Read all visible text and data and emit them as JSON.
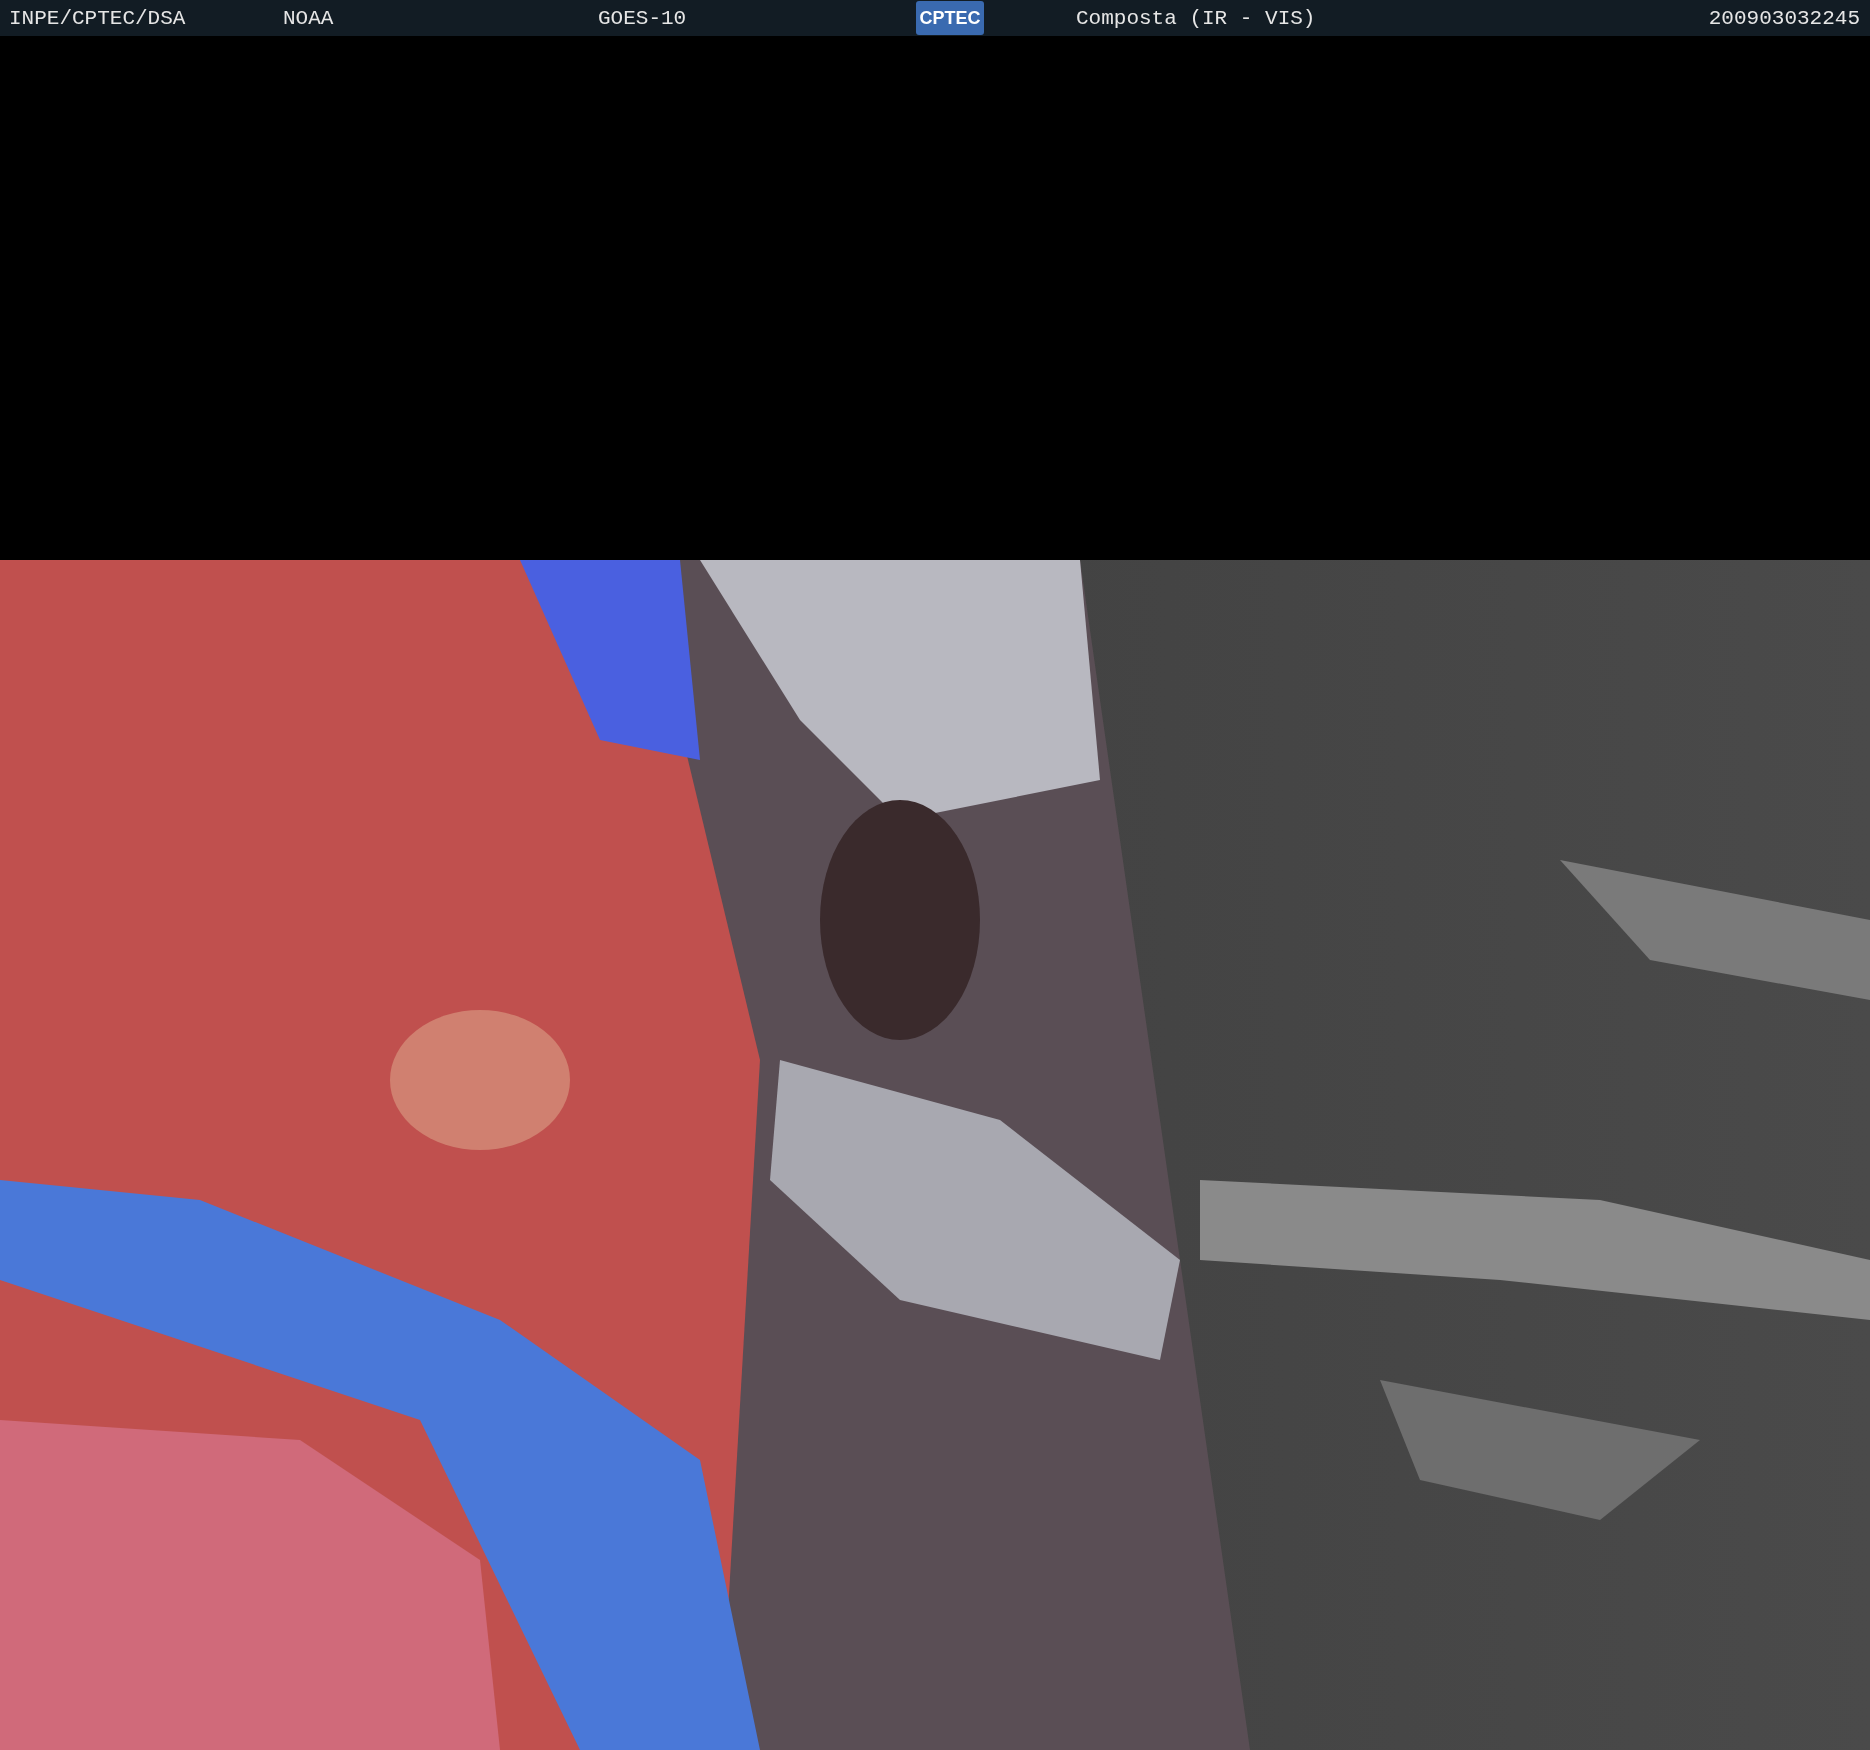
{
  "header": {
    "agency": "INPE/CPTEC/DSA",
    "source": "NOAA",
    "satellite": "GOES-10",
    "logo": "CPTEC",
    "product": "Composta (IR - VIS)",
    "timestamp": "200903032245"
  }
}
